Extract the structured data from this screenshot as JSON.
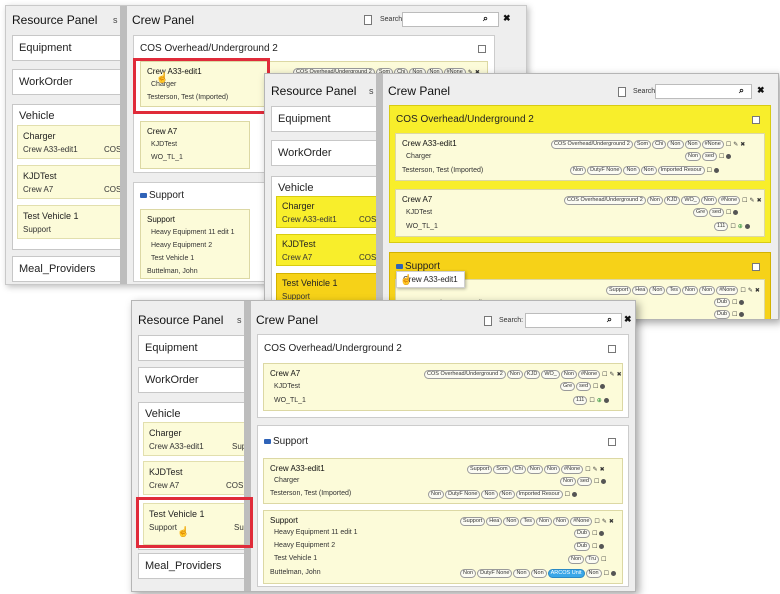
{
  "panel_titles": {
    "resource": "Resource Panel",
    "crew": "Crew Panel",
    "cut": "s"
  },
  "search": {
    "label": "Search:",
    "value": "",
    "placeholder": ""
  },
  "resource": {
    "equipment": "Equipment",
    "workorder": "WorkOrder",
    "vehicle": "Vehicle",
    "meal": "Meal_Providers"
  },
  "vehicles": {
    "v1": {
      "name": "Charger",
      "sub": "Crew A33-edit1",
      "cut1": "COS O",
      "cut2": "COS",
      "cut3": "Sup"
    },
    "v2": {
      "name": "KJDTest",
      "sub": "Crew A7",
      "cut1": "COS O",
      "cut2": "COS",
      "cut3": "COS Ove"
    },
    "v3": {
      "name": "Test Vehicle 1",
      "sub": "Support",
      "cut1": "S",
      "cut2": "Su",
      "cut3": "Supp"
    }
  },
  "sections": {
    "cos": "COS Overhead/Underground 2",
    "support": "Support"
  },
  "crews": {
    "a33": {
      "name": "Crew A33-edit1",
      "l1": "Charger",
      "l2": "Testerson, Test (Imported)"
    },
    "a7": {
      "name": "Crew A7",
      "l1": "KJDTest",
      "l2": "WO_TL_1"
    },
    "sup": {
      "name": "Support",
      "l1": "Heavy Equipment 11 edit 1",
      "l2": "Heavy Equipment 2",
      "l3": "Test Vehicle 1",
      "l4": "Buttelman, John"
    }
  },
  "chips": {
    "cos": "COS Overhead/Underground 2",
    "som": "Som",
    "chi": "Chi",
    "non": "Non",
    "none": "#None",
    "sed": "sed",
    "dutyf": "DutyF None",
    "imported": "Imported Resour",
    "kjd": "KJD",
    "wo": "WO_",
    "gre": "Gre",
    "n111": "111",
    "support": "Support",
    "hea": "Hea",
    "tes": "Tes",
    "dub": "Dub",
    "tru": "Tru",
    "arcos": "ARCOS Unit"
  },
  "drag_label": "Crew A33-edit1",
  "colors": {
    "yellow": "#f8ee2b",
    "orange": "#f6d218",
    "card": "#fcfbd9",
    "highlight": "#e02b3a",
    "blue_chip": "#3aa7e8"
  }
}
